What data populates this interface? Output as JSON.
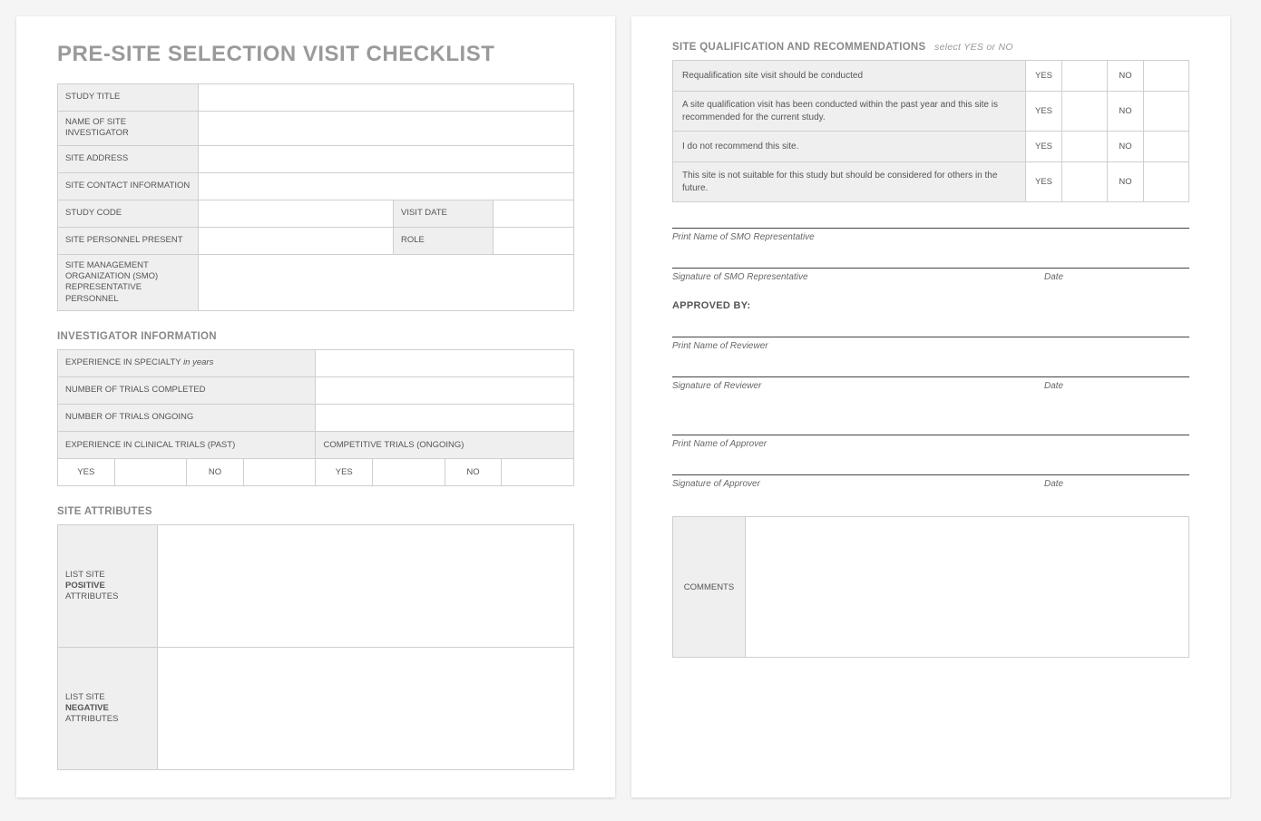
{
  "left": {
    "title": "PRE-SITE SELECTION VISIT CHECKLIST",
    "general": {
      "study_title_label": "STUDY TITLE",
      "investigator_label": "NAME OF SITE INVESTIGATOR",
      "address_label": "SITE ADDRESS",
      "contact_label": "SITE CONTACT INFORMATION",
      "study_code_label": "STUDY CODE",
      "visit_date_label": "VISIT DATE",
      "personnel_label": "SITE PERSONNEL PRESENT",
      "role_label": "ROLE",
      "smo_label": "SITE MANAGEMENT ORGANIZATION (SMO) REPRESENTATIVE PERSONNEL"
    },
    "investigator_section_title": "INVESTIGATOR INFORMATION",
    "investigator": {
      "experience_label": "EXPERIENCE IN SPECIALTY",
      "experience_note": "in years",
      "trials_completed_label": "NUMBER OF TRIALS COMPLETED",
      "trials_ongoing_label": "NUMBER OF TRIALS ONGOING",
      "past_trials_label": "EXPERIENCE IN CLINICAL TRIALS (PAST)",
      "competitive_label": "COMPETITIVE TRIALS (ONGOING)",
      "yes": "YES",
      "no": "NO"
    },
    "attributes_section_title": "SITE ATTRIBUTES",
    "attributes": {
      "positive_pre": "LIST SITE",
      "positive_bold": "POSITIVE",
      "positive_post": "ATTRIBUTES",
      "negative_pre": "LIST SITE",
      "negative_bold": "NEGATIVE",
      "negative_post": "ATTRIBUTES"
    }
  },
  "right": {
    "qual_title": "SITE QUALIFICATION AND RECOMMENDATIONS",
    "qual_note": "select YES or NO",
    "questions": [
      "Requalification site visit should be conducted",
      "A site qualification visit has been conducted within the past year and this site is recommended for the current study.",
      "I do not recommend this site.",
      "This site is not suitable for this study but should be considered for others in the future."
    ],
    "yes": "YES",
    "no": "NO",
    "sig": {
      "smo_name": "Print Name of SMO Representative",
      "smo_sig": "Signature of SMO Representative",
      "date": "Date",
      "approved": "APPROVED BY:",
      "rev_name": "Print Name of Reviewer",
      "rev_sig": "Signature of Reviewer",
      "app_name": "Print Name of Approver",
      "app_sig": "Signature of Approver"
    },
    "comments_label": "COMMENTS"
  }
}
